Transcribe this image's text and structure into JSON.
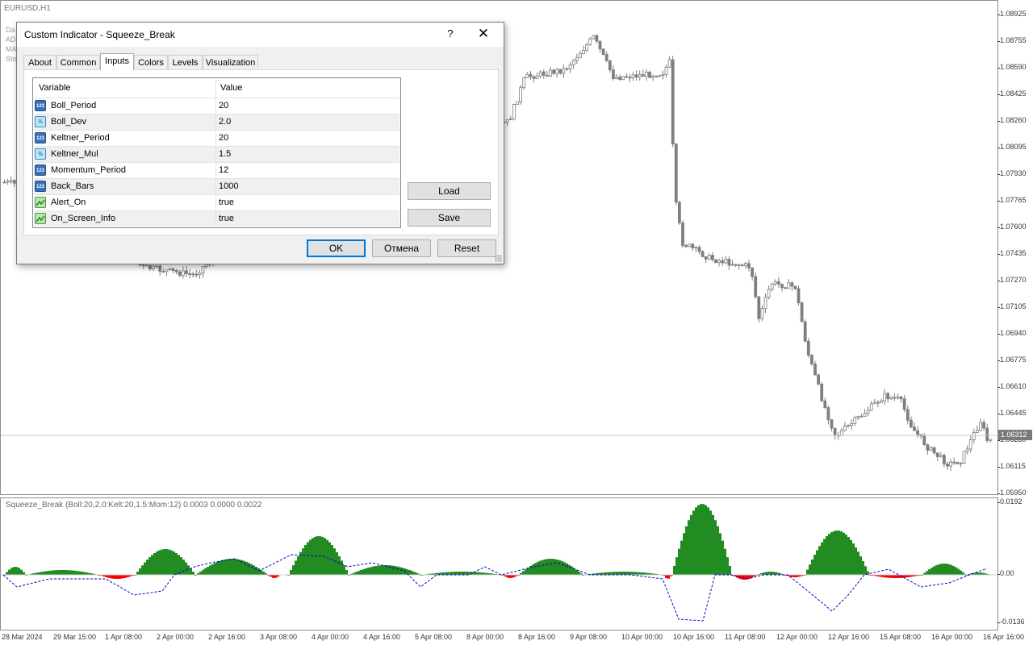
{
  "chart": {
    "symbol": "EURUSD,H1",
    "legend_lines": [
      "Da",
      "AD",
      "MA",
      "Sto"
    ],
    "y_ticks": [
      "1.08925",
      "1.08755",
      "1.08590",
      "1.08425",
      "1.08260",
      "1.08095",
      "1.07930",
      "1.07765",
      "1.07600",
      "1.07435",
      "1.07270",
      "1.07105",
      "1.06940",
      "1.06775",
      "1.06610",
      "1.06445",
      "1.06280",
      "1.06115",
      "1.05950"
    ],
    "current_price": "1.06312",
    "indicator_label": "Squeeze_Break (Boll:20,2.0:Kelt:20,1.5:Mom:12) 0.0003 0.0000 0.0022",
    "indicator_y_ticks": [
      "0.0192",
      "0.00",
      "-0.0136"
    ],
    "x_ticks": [
      "28 Mar 2024",
      "29 Mar 15:00",
      "1 Apr 08:00",
      "2 Apr 00:00",
      "2 Apr 16:00",
      "3 Apr 08:00",
      "4 Apr 00:00",
      "4 Apr 16:00",
      "5 Apr 08:00",
      "8 Apr 00:00",
      "8 Apr 16:00",
      "9 Apr 08:00",
      "10 Apr 00:00",
      "10 Apr 16:00",
      "11 Apr 08:00",
      "12 Apr 00:00",
      "12 Apr 16:00",
      "15 Apr 08:00",
      "16 Apr 00:00",
      "16 Apr 16:00"
    ],
    "colors": {
      "candle": "#7f7f7f",
      "hist_up": "#228b22",
      "hist_down": "#ff0000",
      "momentum_line": "#0000cd"
    }
  },
  "dialog": {
    "title": "Custom Indicator - Squeeze_Break",
    "help": "?",
    "close": "✕",
    "tabs": [
      "About",
      "Common",
      "Inputs",
      "Colors",
      "Levels",
      "Visualization"
    ],
    "active_tab": "Inputs",
    "columns": {
      "variable": "Variable",
      "value": "Value"
    },
    "params": [
      {
        "name": "Boll_Period",
        "value": "20",
        "type": "int",
        "icon": "123"
      },
      {
        "name": "Boll_Dev",
        "value": "2.0",
        "type": "double",
        "icon": "½"
      },
      {
        "name": "Keltner_Period",
        "value": "20",
        "type": "int",
        "icon": "123"
      },
      {
        "name": "Keltner_Mul",
        "value": "1.5",
        "type": "double",
        "icon": "½"
      },
      {
        "name": "Momentum_Period",
        "value": "12",
        "type": "int",
        "icon": "123"
      },
      {
        "name": "Back_Bars",
        "value": "1000",
        "type": "int",
        "icon": "123"
      },
      {
        "name": "Alert_On",
        "value": "true",
        "type": "bool",
        "icon": ""
      },
      {
        "name": "On_Screen_Info",
        "value": "true",
        "type": "bool",
        "icon": ""
      }
    ],
    "buttons": {
      "load": "Load",
      "save": "Save",
      "ok": "OK",
      "cancel": "Отмена",
      "reset": "Reset"
    }
  }
}
